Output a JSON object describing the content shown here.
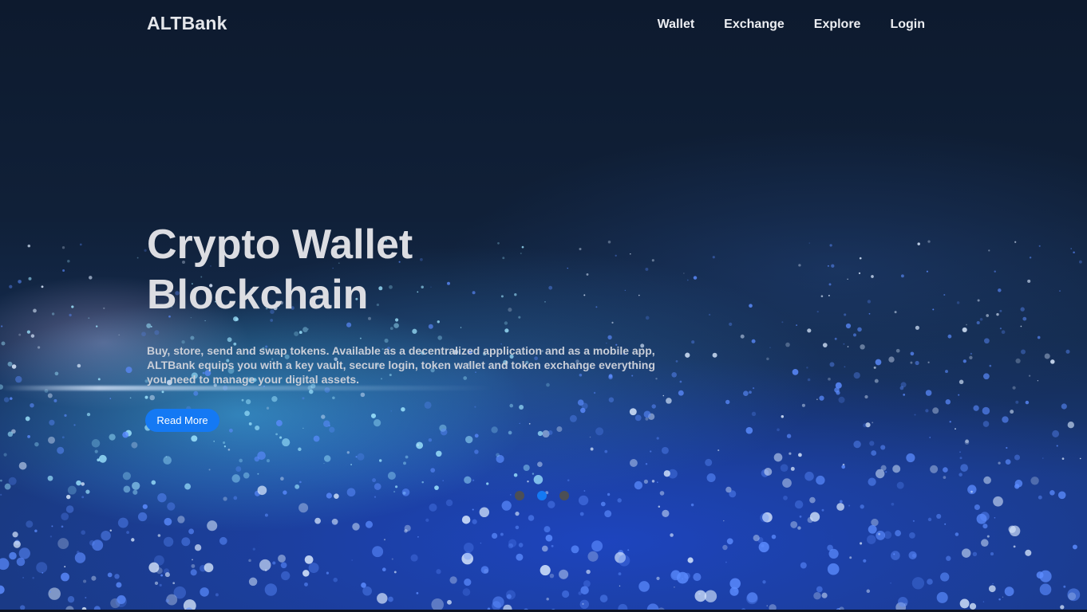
{
  "brand": "ALTBank",
  "nav": [
    "Wallet",
    "Exchange",
    "Explore",
    "Login"
  ],
  "hero": {
    "headline_line1": "Crypto Wallet",
    "headline_line2": "Blockchain",
    "description": "Buy, store, send and swap tokens. Available as a decentralized application and as a mobile app, ALTBank equips you with a key vault, secure login, token wallet and token exchange everything you need to manage your digital assets.",
    "cta_label": "Read More"
  },
  "carousel": {
    "slide_count": 3,
    "active_index": 1
  },
  "colors": {
    "accent": "#1479f4",
    "inactive_dot": "#4c4f56",
    "text": "#dcdde2"
  }
}
